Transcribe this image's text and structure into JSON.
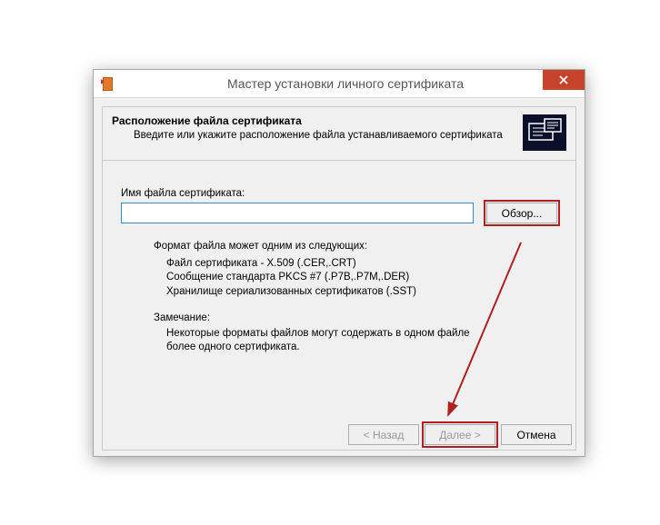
{
  "window": {
    "title": "Мастер установки личного сертификата"
  },
  "header": {
    "title": "Расположение файла сертификата",
    "subtitle": "Введите или укажите расположение файла устанавливаемого сертификата"
  },
  "form": {
    "filename_label": "Имя файла сертификата:",
    "filename_value": "",
    "browse_label": "Обзор..."
  },
  "info": {
    "intro": "Формат файла может одним из следующих:",
    "format1": "Файл сертификата - X.509 (.CER,.CRT)",
    "format2": "Сообщение стандарта PKCS #7 (.P7B,.P7M,.DER)",
    "format3": "Хранилище сериализованных сертификатов (.SST)",
    "note_title": "Замечание:",
    "note_body": "Некоторые форматы файлов могут содержать в одном файле более одного сертификата."
  },
  "buttons": {
    "back": "< Назад",
    "next": "Далее >",
    "cancel": "Отмена"
  }
}
